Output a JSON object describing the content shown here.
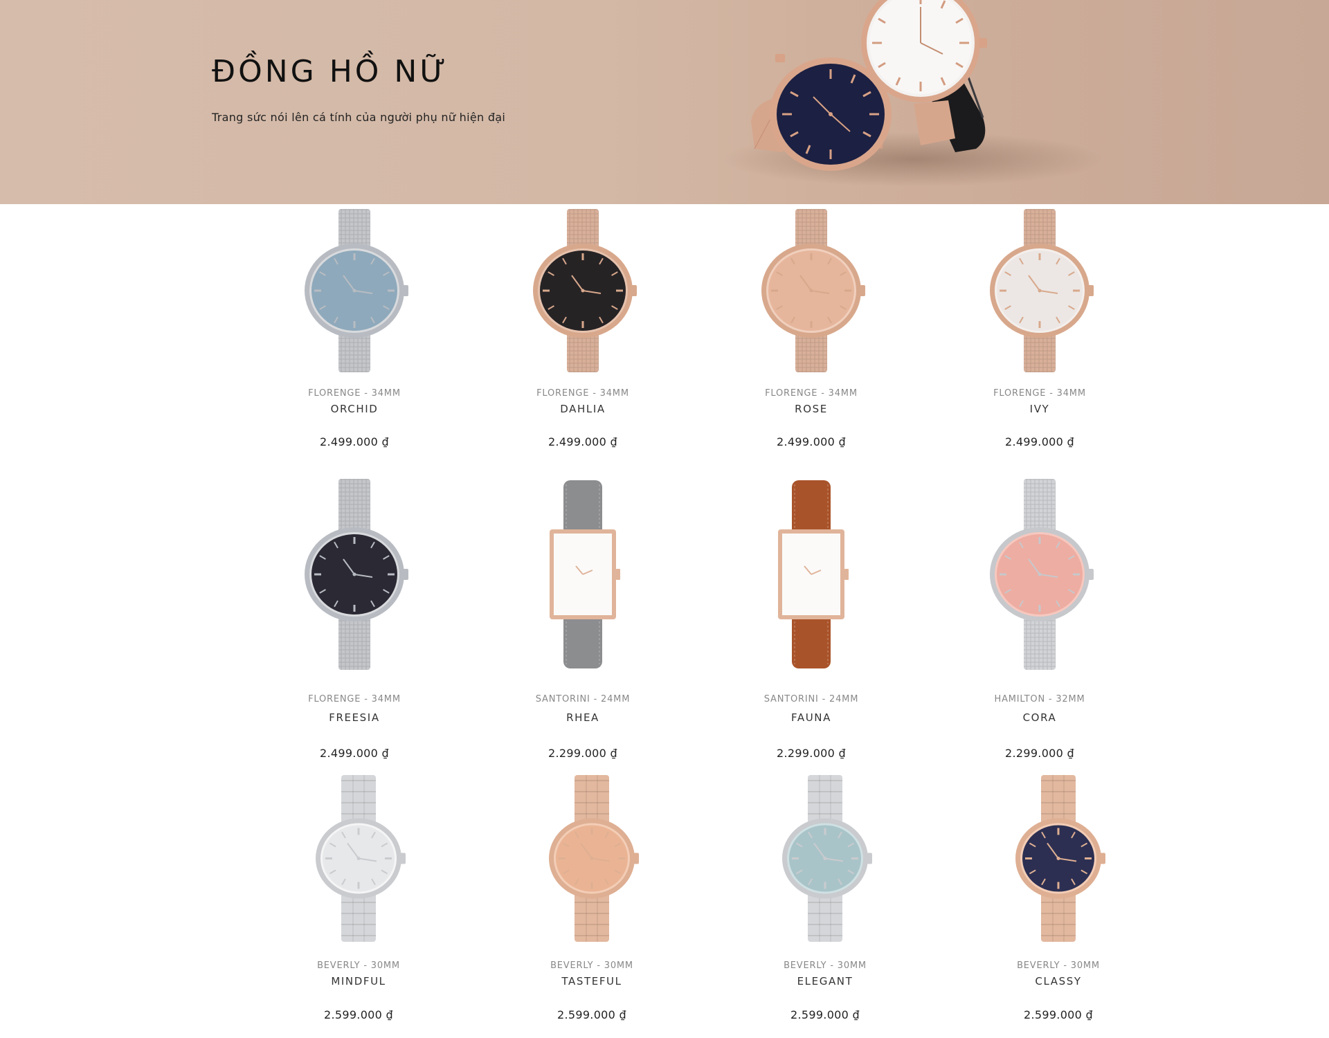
{
  "hero": {
    "title": "ĐỒNG HỒ NỮ",
    "subtitle": "Trang sức nói lên cá tính của người phụ nữ hiện đại",
    "colors": {
      "background": "#d3b8a6"
    }
  },
  "products": [
    {
      "collection": "FLORENGE - 34MM",
      "name": "ORCHID",
      "price": "2.499.000 ₫",
      "strap": "mesh",
      "case": "round",
      "case_color": "#b8bcc2",
      "dial_color": "#8ea9bb",
      "strap_color": "#c4c6ca",
      "accent": "#d8dadd"
    },
    {
      "collection": "FLORENGE - 34MM",
      "name": "DAHLIA",
      "price": "2.499.000 ₫",
      "strap": "mesh",
      "case": "round",
      "case_color": "#d8a88c",
      "dial_color": "#262325",
      "strap_color": "#d9b09a",
      "accent": "#e6c2ad"
    },
    {
      "collection": "FLORENGE - 34MM",
      "name": "ROSE",
      "price": "2.499.000 ₫",
      "strap": "mesh",
      "case": "round",
      "case_color": "#d8a88c",
      "dial_color": "#e6b69c",
      "strap_color": "#d9b09a",
      "accent": "#f0cfbd"
    },
    {
      "collection": "FLORENGE - 34MM",
      "name": "IVY",
      "price": "2.499.000 ₫",
      "strap": "mesh",
      "case": "round",
      "case_color": "#d8a88c",
      "dial_color": "#ece7e4",
      "strap_color": "#d9b09a",
      "accent": "#f4efec"
    },
    {
      "collection": "FLORENGE - 34MM",
      "name": "FREESIA",
      "price": "2.499.000 ₫",
      "strap": "mesh",
      "case": "round",
      "case_color": "#b8bcc2",
      "dial_color": "#2a2934",
      "strap_color": "#c4c6ca",
      "accent": "#d8dadd"
    },
    {
      "collection": "SANTORINI - 24MM",
      "name": "RHEA",
      "price": "2.299.000 ₫",
      "strap": "leather",
      "case": "rect",
      "case_color": "#e0b49a",
      "dial_color": "#fbfaf9",
      "strap_color": "#8c8d8f",
      "accent": "#ffffff"
    },
    {
      "collection": "SANTORINI - 24MM",
      "name": "FAUNA",
      "price": "2.299.000 ₫",
      "strap": "leather",
      "case": "rect",
      "case_color": "#e0b49a",
      "dial_color": "#fbfaf9",
      "strap_color": "#a9532a",
      "accent": "#ffffff"
    },
    {
      "collection": "HAMILTON - 32MM",
      "name": "CORA",
      "price": "2.299.000 ₫",
      "strap": "mesh",
      "case": "round",
      "case_color": "#c6c8cc",
      "dial_color": "#eeada2",
      "strap_color": "#d1d3d6",
      "accent": "#f6c8bf"
    },
    {
      "collection": "BEVERLY - 30MM",
      "name": "MINDFUL",
      "price": "2.599.000 ₫",
      "strap": "link",
      "case": "round",
      "case_color": "#c9cbce",
      "dial_color": "#e7e8ea",
      "strap_color": "#d4d6d9",
      "accent": "#f5f5f6"
    },
    {
      "collection": "BEVERLY - 30MM",
      "name": "TASTEFUL",
      "price": "2.599.000 ₫",
      "strap": "link",
      "case": "round",
      "case_color": "#deaf93",
      "dial_color": "#eab494",
      "strap_color": "#e2b89e",
      "accent": "#f3cdb6"
    },
    {
      "collection": "BEVERLY - 30MM",
      "name": "ELEGANT",
      "price": "2.599.000 ₫",
      "strap": "link",
      "case": "round",
      "case_color": "#c9cbce",
      "dial_color": "#a9c4c9",
      "strap_color": "#d4d6d9",
      "accent": "#cfe0e3"
    },
    {
      "collection": "BEVERLY - 30MM",
      "name": "CLASSY",
      "price": "2.599.000 ₫",
      "strap": "link",
      "case": "round",
      "case_color": "#deaf93",
      "dial_color": "#2c2f52",
      "strap_color": "#e2b89e",
      "accent": "#f3cdb6"
    }
  ]
}
